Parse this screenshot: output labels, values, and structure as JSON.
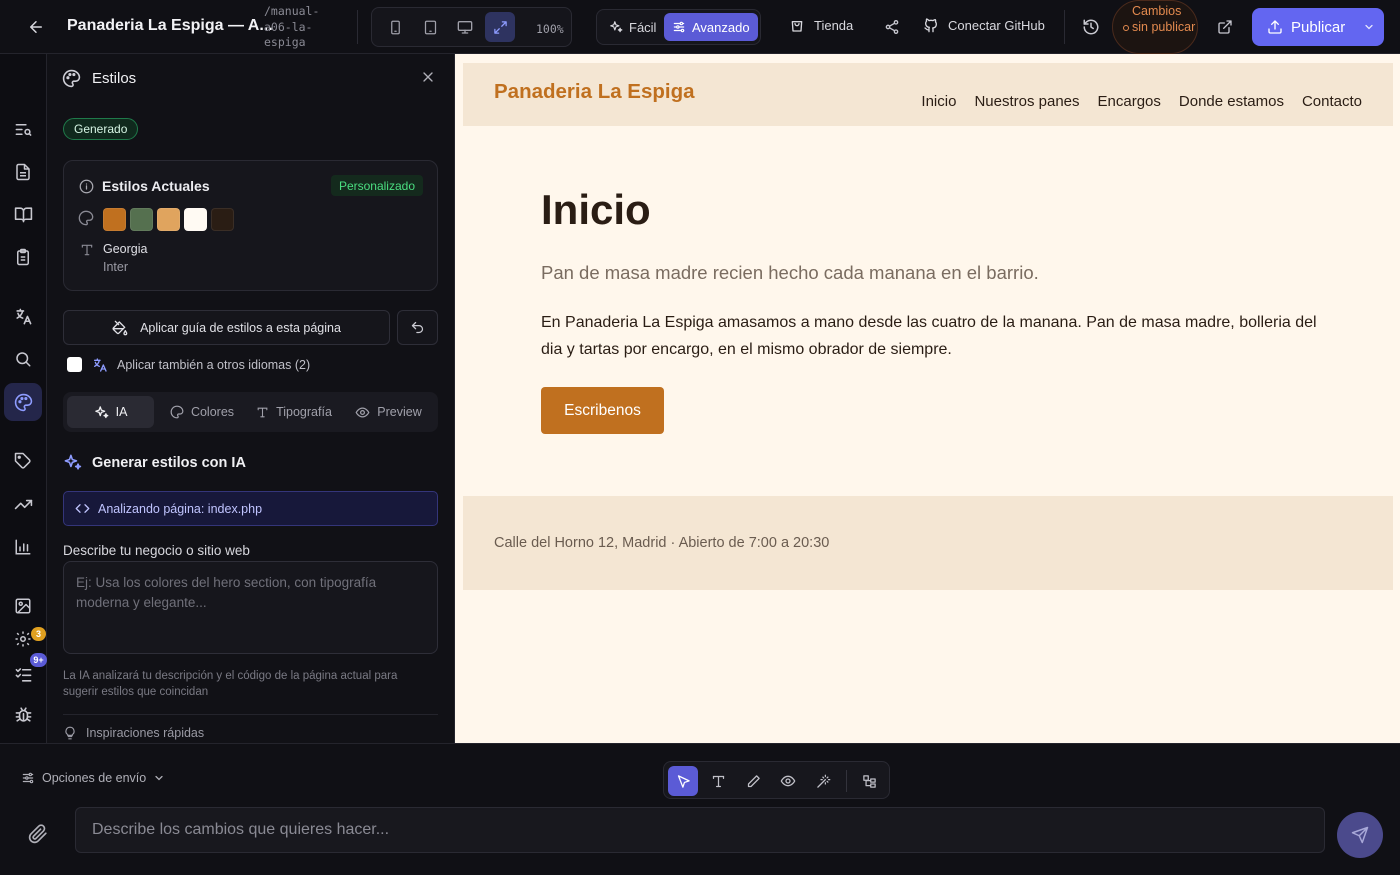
{
  "topbar": {
    "title": "Panaderia La Espiga — A...",
    "slug": "/manual-a06-la-espiga",
    "zoom": "100%",
    "mode_easy": "Fácil",
    "mode_advanced": "Avanzado",
    "store": "Tienda",
    "github": "Conectar GitHub",
    "unsaved": "Cambios sin publicar",
    "publish": "Publicar"
  },
  "rail": {
    "badge_updates": "3",
    "badge_tasks": "9+"
  },
  "panel": {
    "title": "Estilos",
    "generated_badge": "Generado",
    "current_styles_title": "Estilos Actuales",
    "custom_badge": "Personalizado",
    "colors": [
      "#c0701f",
      "#55704f",
      "#e0a45e",
      "#fffaf3",
      "#2a1d14"
    ],
    "font_primary": "Georgia",
    "font_secondary": "Inter",
    "apply_button": "Aplicar guía de estilos a esta página",
    "also_languages": "Aplicar también a otros idiomas (2)",
    "tabs": {
      "ai": "IA",
      "colors": "Colores",
      "typography": "Tipografía",
      "preview": "Preview"
    },
    "generate_title": "Generar estilos con IA",
    "analyzing": "Analizando página: index.php",
    "describe_label": "Describe tu negocio o sitio web",
    "describe_placeholder": "Ej: Usa los colores del hero section, con tipografía moderna y elegante...",
    "help_text": "La IA analizará tu descripción y el código de la página actual para sugerir estilos que coincidan",
    "quick_inspirations": "Inspiraciones rápidas"
  },
  "site": {
    "logo": "Panaderia La Espiga",
    "nav": [
      "Inicio",
      "Nuestros panes",
      "Encargos",
      "Donde estamos",
      "Contacto"
    ],
    "heading": "Inicio",
    "subheading": "Pan de masa madre recien hecho cada manana en el barrio.",
    "body": "En Panaderia La Espiga amasamos a mano desde las cuatro de la manana. Pan de masa madre, bolleria del dia y tartas por encargo, en el mismo obrador de siempre.",
    "cta": "Escribenos",
    "footer": "Calle del Horno 12, Madrid · Abierto de 7:00 a 20:30"
  },
  "bottom": {
    "send_options": "Opciones de envío",
    "prompt_placeholder": "Describe los cambios que quieres hacer..."
  }
}
